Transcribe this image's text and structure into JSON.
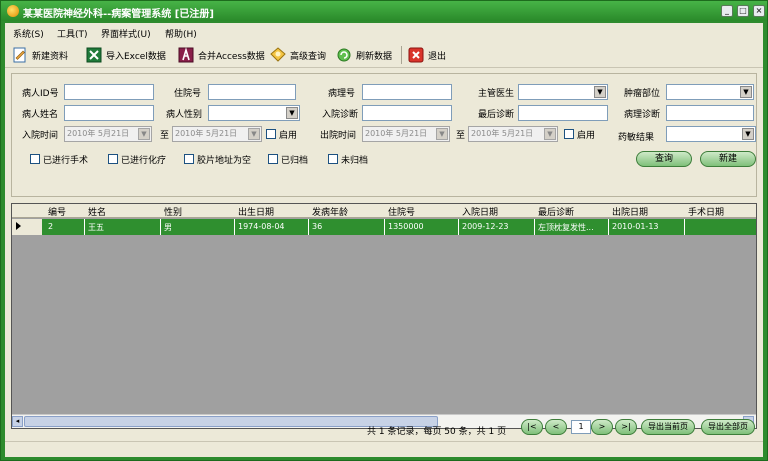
{
  "window": {
    "title": "某某医院神经外科--病案管理系统 [已注册]"
  },
  "menu": [
    {
      "label": "系统(S)"
    },
    {
      "label": "工具(T)"
    },
    {
      "label": "界面样式(U)"
    },
    {
      "label": "帮助(H)"
    }
  ],
  "toolbar": {
    "new": "新建资料",
    "import_excel": "导入Excel数据",
    "merge_access": "合并Access数据",
    "advanced_query": "高级查询",
    "refresh": "刷新数据",
    "exit": "退出"
  },
  "search": {
    "patient_id": "病人ID号",
    "inpatient_no": "住院号",
    "pathology_no": "病理号",
    "doctor": "主管医生",
    "tumor_site": "肿瘤部位",
    "patient_name": "病人姓名",
    "patient_sex": "病人性别",
    "admit_diag": "入院诊断",
    "final_diag": "最后诊断",
    "path_diag": "病理诊断",
    "admit_time": "入院时间",
    "discharge_time": "出院时间",
    "to": "至",
    "enable": "启用",
    "drug_result": "药敏结果",
    "date_value": "2010年 5月21日",
    "done_surgery": "已进行手术",
    "done_chemo": "已进行化疗",
    "film_empty": "胶片地址为空",
    "archived": "已归档",
    "not_archived": "未归档",
    "query_btn": "查询",
    "new_btn": "新建"
  },
  "grid": {
    "columns": [
      "编号",
      "姓名",
      "性别",
      "出生日期",
      "发病年龄",
      "住院号",
      "入院日期",
      "最后诊断",
      "出院日期",
      "手术日期"
    ],
    "rows": [
      [
        "2",
        "王五",
        "男",
        "1974-08-04",
        "36",
        "1350000",
        "2009-12-23",
        "左顶枕复发性...",
        "2010-01-13",
        ""
      ]
    ]
  },
  "pager": {
    "summary": "共 1 条记录，每页 50 条，共 1 页",
    "page": "1",
    "first": "|<",
    "prev": "<",
    "next": ">",
    "last": ">|",
    "export_current": "导出当前页",
    "export_all": "导出全部页"
  }
}
